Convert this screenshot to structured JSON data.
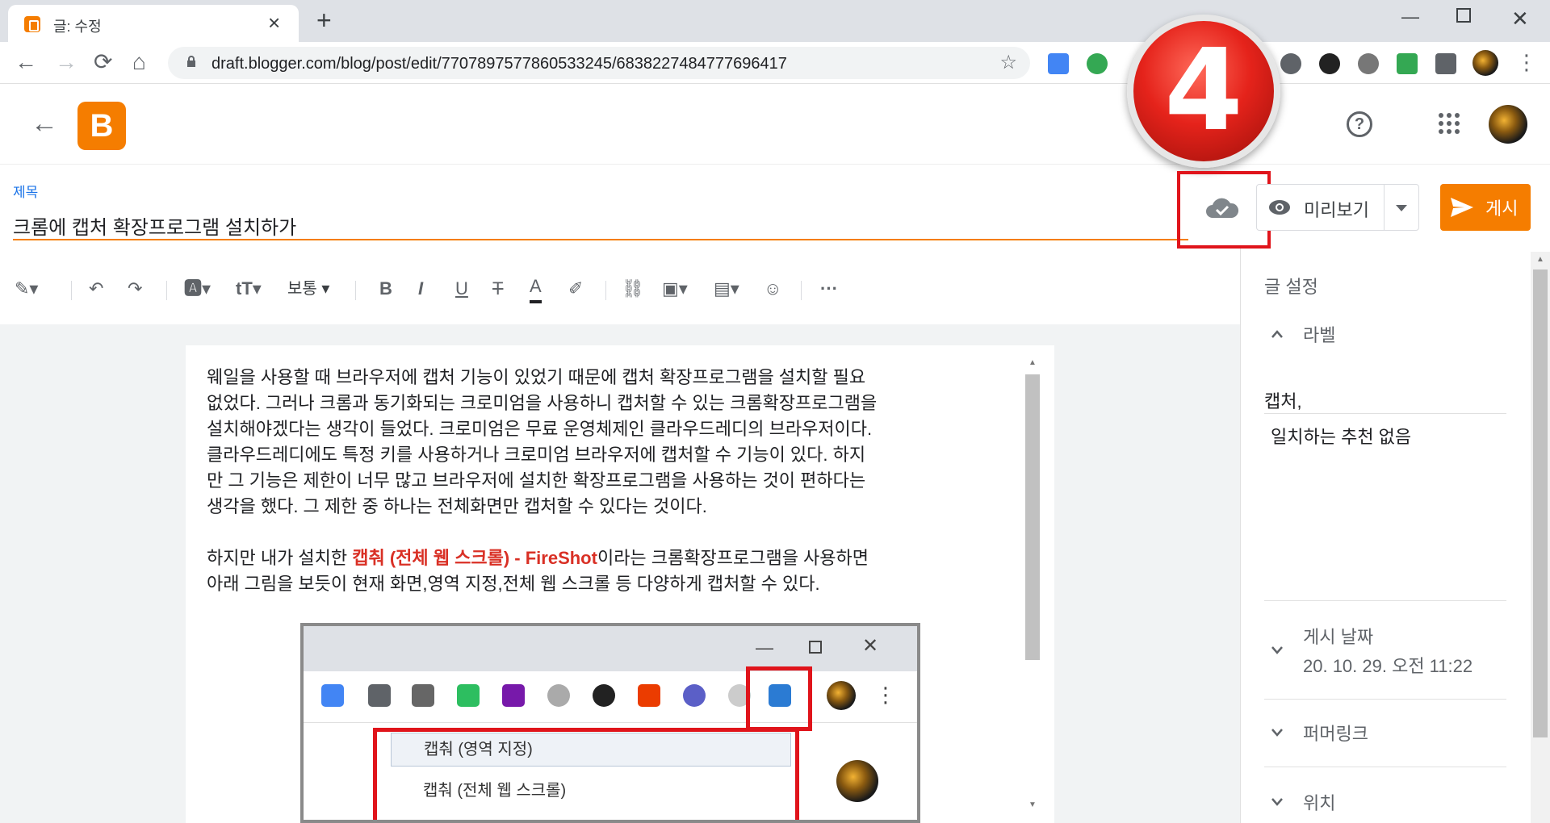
{
  "browser": {
    "tab_title": "글: 수정",
    "url": "draft.blogger.com/blog/post/edit/7707897577860533245/6838227484777696417"
  },
  "step_badge": "4",
  "editor": {
    "title_label": "제목",
    "title": "크롬에 캡처 확장프로그램 설치하가",
    "preview_label": "미리보기",
    "publish_label": "게시",
    "font_size": "보통"
  },
  "content": {
    "p1": [
      "웨일을 사용할 때 브라우저에 캡처 기능이 있었기 때문에 캡처 확장프로그램을 설치할 필요",
      "없었다. 그러나 크롬과 동기화되는 크로미엄을 사용하니 캡처할 수 있는 크롬확장프로그램을",
      "설치해야겠다는 생각이 들었다. 크로미엄은 무료 운영체제인 클라우드레디의 브라우저이다.",
      "클라우드레디에도 특정 키를 사용하거나 크로미엄 브라우저에  캡처할 수 기능이 있다. 하지",
      "만 그 기능은 제한이 너무 많고 브라우저에 설치한 확장프로그램을 사용하는 것이 편하다는",
      "생각을 했다. 그 제한 중 하나는 전체화면만 캡처할 수 있다는 것이다."
    ],
    "p2_prefix": "하지만 내가 설치한 ",
    "p2_highlight": "캡춰 (전체 웹 스크롤) - FireShot",
    "p2_suffix": "이라는 크롬확장프로그램을 사용하면",
    "p2_line2": "아래 그림을 보듯이 현재 화면,영역 지정,전체 웹 스크롤 등 다양하게 캡처할 수 있다.",
    "image_menu": [
      "캡춰 (영역 지정)",
      "캡춰 (전체 웹 스크롤)"
    ]
  },
  "sidebar": {
    "heading": "글 설정",
    "labels_title": "라벨",
    "labels_value": "캡처,",
    "labels_hint": "일치하는 추천 없음",
    "date_title": "게시 날짜",
    "date_value": "20. 10. 29. 오전 11:22",
    "permalink_title": "퍼머링크",
    "location_title": "위치"
  },
  "colors": {
    "accent": "#f57d00",
    "highlight_red": "#e0141b",
    "link_blue": "#1a73e8"
  }
}
